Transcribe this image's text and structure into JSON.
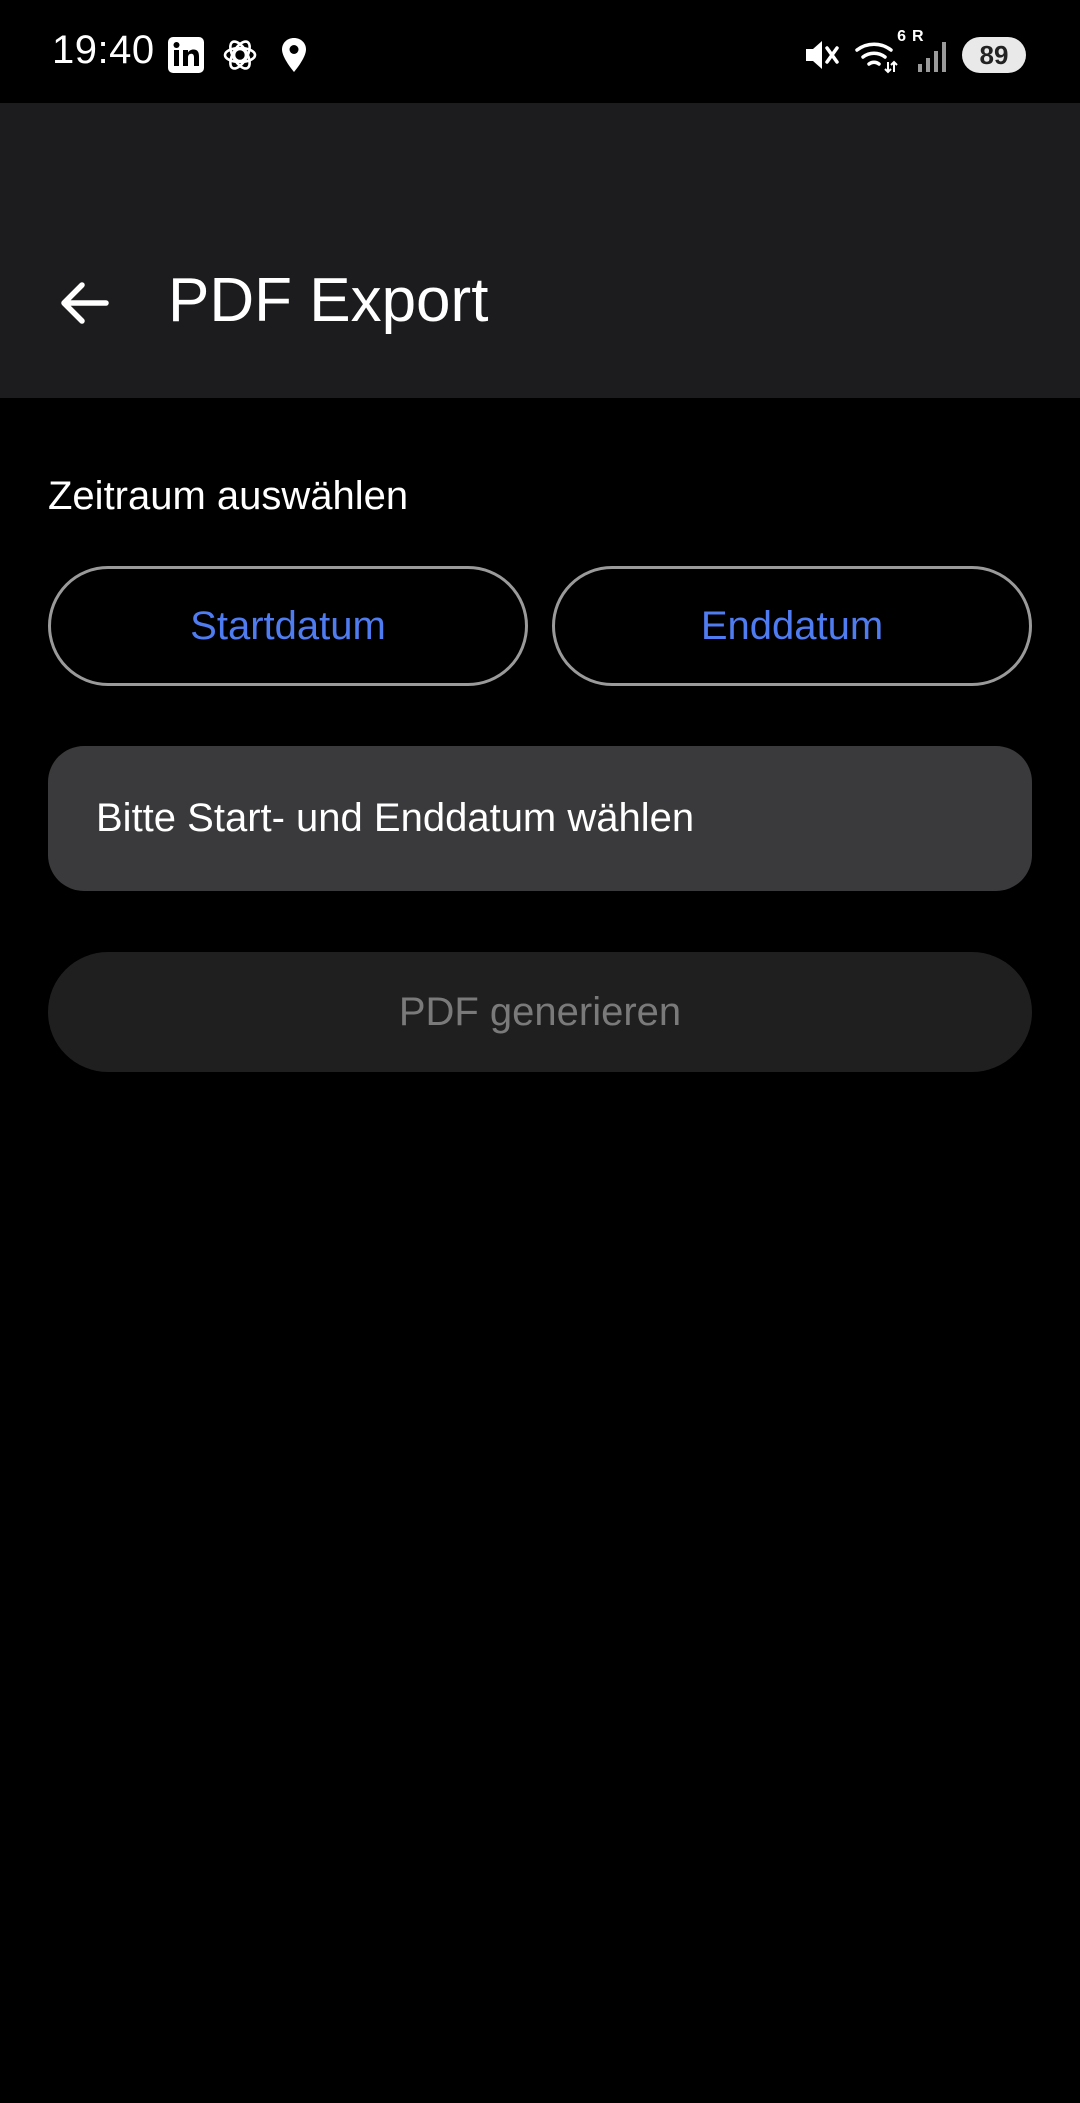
{
  "status_bar": {
    "time": "19:40",
    "left_icons": [
      "linkedin-icon",
      "chatgpt-icon",
      "location-icon"
    ],
    "right_icons": [
      "mute-icon",
      "wifi-icon",
      "signal-icon"
    ],
    "wifi_badge": "6",
    "signal_badge": "R",
    "battery": "89"
  },
  "app_bar": {
    "title": "PDF Export",
    "back_icon": "arrow-left-icon"
  },
  "content": {
    "section_label": "Zeitraum auswählen",
    "start_date_label": "Startdatum",
    "end_date_label": "Enddatum",
    "info_text": "Bitte Start- und Enddatum wählen",
    "generate_label": "PDF generieren",
    "generate_enabled": false
  },
  "colors": {
    "background": "#000000",
    "app_bar": "#1c1c1e",
    "accent": "#4f7cf0",
    "info_box": "#3a3a3c",
    "disabled_button": "#1f1f1f",
    "disabled_text": "#7a7a7a"
  }
}
